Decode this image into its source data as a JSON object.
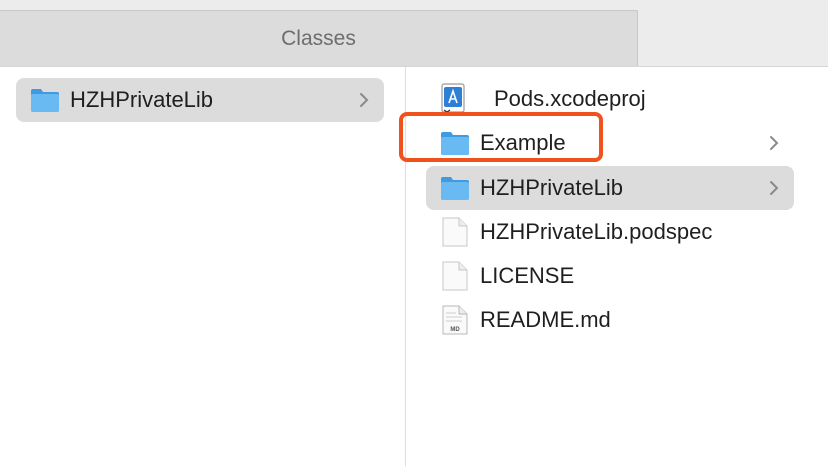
{
  "tabbar": {
    "active_tab": "Classes"
  },
  "column1": {
    "items": [
      {
        "label": "HZHPrivateLib",
        "icon": "folder-icon",
        "has_children": true,
        "selected": true
      }
    ]
  },
  "column2": {
    "items": [
      {
        "label": "Pods.xcodeproj",
        "icon": "xcodeproj-icon",
        "has_children": false
      },
      {
        "label": "Example",
        "icon": "folder-icon",
        "has_children": true,
        "highlighted": true
      },
      {
        "label": "HZHPrivateLib",
        "icon": "folder-icon",
        "has_children": true,
        "selected": true
      },
      {
        "label": "HZHPrivateLib.podspec",
        "icon": "document-icon",
        "has_children": false
      },
      {
        "label": "LICENSE",
        "icon": "document-icon",
        "has_children": false
      },
      {
        "label": "README.md",
        "icon": "markdown-document-icon",
        "icon_text": "MD",
        "has_children": false
      }
    ]
  },
  "colors": {
    "folder_blue": "#5eb1ef",
    "selection_gray": "#dcdcdc",
    "highlight_orange": "#f0521d"
  }
}
